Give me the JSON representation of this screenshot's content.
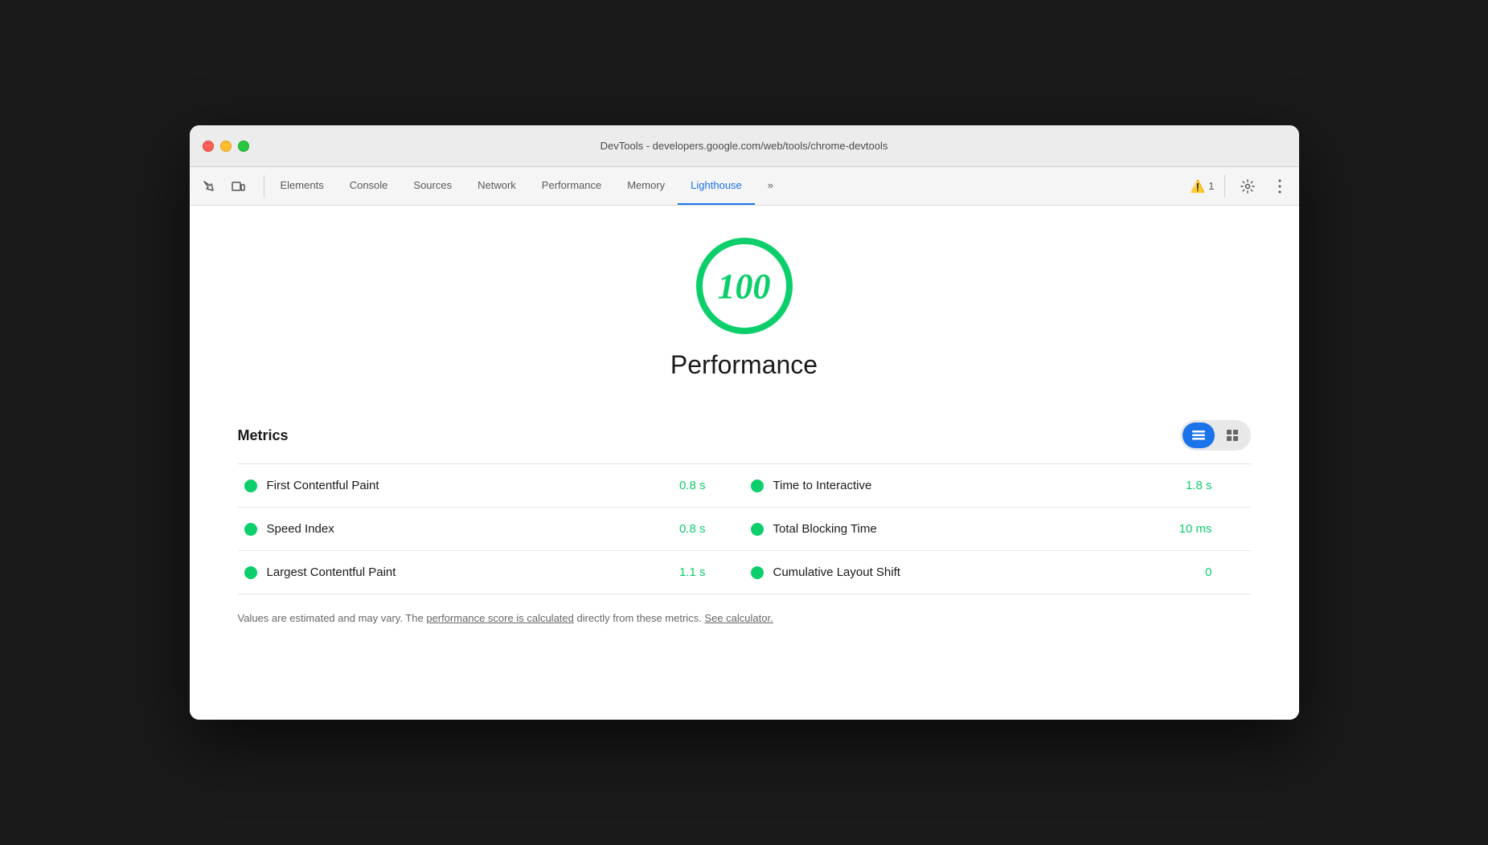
{
  "window": {
    "title": "DevTools - developers.google.com/web/tools/chrome-devtools"
  },
  "tabs": [
    {
      "id": "elements",
      "label": "Elements",
      "active": false
    },
    {
      "id": "console",
      "label": "Console",
      "active": false
    },
    {
      "id": "sources",
      "label": "Sources",
      "active": false
    },
    {
      "id": "network",
      "label": "Network",
      "active": false
    },
    {
      "id": "performance",
      "label": "Performance",
      "active": false
    },
    {
      "id": "memory",
      "label": "Memory",
      "active": false
    },
    {
      "id": "lighthouse",
      "label": "Lighthouse",
      "active": true
    },
    {
      "id": "more",
      "label": "»",
      "active": false
    }
  ],
  "toolbar": {
    "warning_count": "1",
    "warning_label": "1"
  },
  "score": {
    "value": "100",
    "label": "Performance"
  },
  "metrics": {
    "title": "Metrics",
    "view_toggle": {
      "list_label": "≡",
      "grid_label": "☰"
    },
    "items": [
      {
        "row": 0,
        "left": {
          "name": "First Contentful Paint",
          "value": "0.8 s"
        },
        "right": {
          "name": "Time to Interactive",
          "value": "1.8 s"
        }
      },
      {
        "row": 1,
        "left": {
          "name": "Speed Index",
          "value": "0.8 s"
        },
        "right": {
          "name": "Total Blocking Time",
          "value": "10 ms"
        }
      },
      {
        "row": 2,
        "left": {
          "name": "Largest Contentful Paint",
          "value": "1.1 s"
        },
        "right": {
          "name": "Cumulative Layout Shift",
          "value": "0"
        }
      }
    ]
  },
  "footer": {
    "text_before": "Values are estimated and may vary. The ",
    "link1": "performance score is calculated",
    "text_middle": " directly from these metrics. ",
    "link2": "See calculator.",
    "text_after": ""
  }
}
